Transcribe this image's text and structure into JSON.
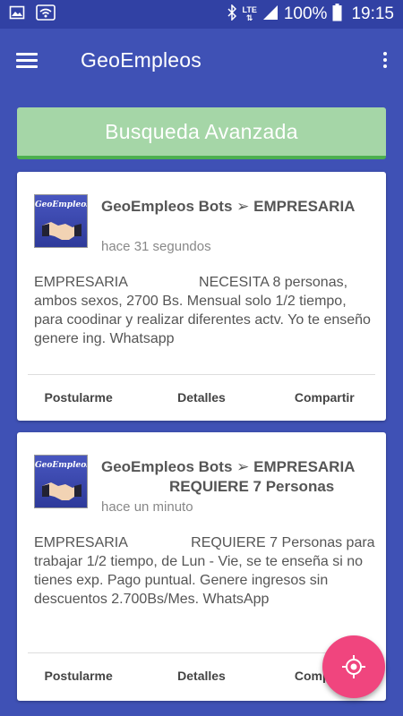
{
  "status_bar": {
    "network_label": "LTE",
    "battery": "100%",
    "time": "19:15"
  },
  "app_bar": {
    "title": "GeoEmpleos"
  },
  "search": {
    "label": "Busqueda Avanzada"
  },
  "cards": [
    {
      "logo_text": "GeoEmpleos",
      "header": "GeoEmpleos Bots ➢ EMPRESARIA",
      "time": "hace 31 segundos",
      "body": "EMPRESARIA                  NECESITA 8 personas, ambos sexos, 2700 Bs. Mensual solo 1/2 tiempo, para coodinar y realizar diferentes actv. Yo te enseño genere ing. Whatsapp",
      "actions": [
        "Postularme",
        "Detalles",
        "Compartir"
      ]
    },
    {
      "logo_text": "GeoEmpleos",
      "header_line1": "GeoEmpleos Bots ➢ EMPRESARIA",
      "header_line2": "REQUIERE 7 Personas",
      "time": "hace un minuto",
      "body": "EMPRESARIA                REQUIERE 7 Personas para trabajar 1/2 tiempo, de Lun - Vie, se te enseña si no tienes exp. Pago puntual. Genere ingresos sin descuentos 2.700Bs/Mes. WhatsApp",
      "actions": [
        "Postularme",
        "Detalles",
        "Compartir"
      ]
    }
  ],
  "colors": {
    "primary": "#3F51B5",
    "status_bar": "#3141A4",
    "search_bg": "#A5D6A7",
    "search_border": "#4CAF50",
    "fab": "#F0457E"
  },
  "icons": {
    "status_left": [
      "image-icon",
      "wifi-icon"
    ],
    "status_right": [
      "bluetooth-icon",
      "signal-icon",
      "battery-icon"
    ],
    "app_bar": [
      "menu-icon",
      "overflow-menu-icon"
    ],
    "card_logo": "handshake-icon",
    "fab": "location-target-icon"
  }
}
